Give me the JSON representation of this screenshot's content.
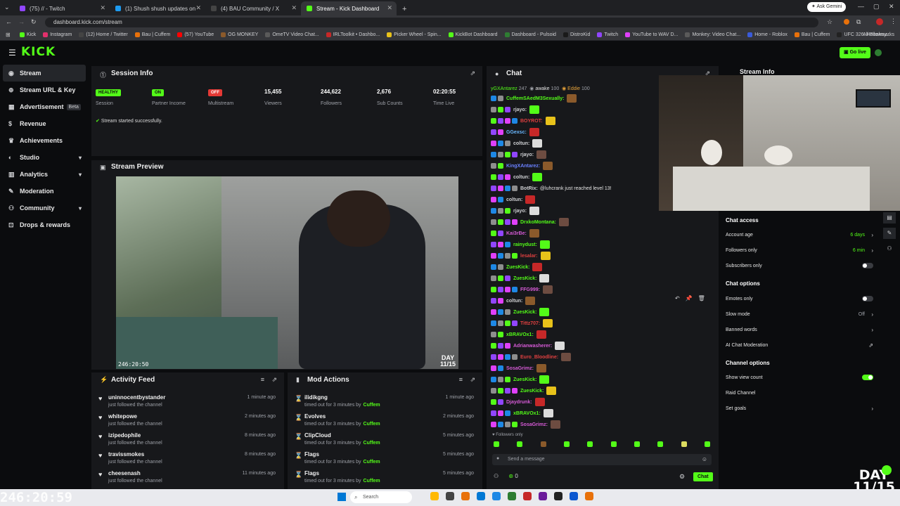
{
  "browser": {
    "tabs": [
      {
        "title": "(75) // - Twitch",
        "color": "#9146ff"
      },
      {
        "title": "(1) Shush shush updates on",
        "color": "#1d9bf0"
      },
      {
        "title": "(4) BAU Community / X",
        "color": "#111"
      },
      {
        "title": "Stream - Kick Dashboard",
        "color": "#53fc18",
        "active": true
      }
    ],
    "new_tab": "+",
    "ask_gemini": "Ask Gemini",
    "url": "dashboard.kick.com/stream",
    "bookmarks": [
      "Kick",
      "Instagram",
      "(12) Home / Twitter",
      "Bau | Cuffem",
      "(57) YouTube",
      "OG MONKEY",
      "OmeTV Video Chat...",
      "IRLToolkit • Dashbo...",
      "Picker Wheel - Spin...",
      "KickBot Dashboard",
      "Dashboard - Pulsoid",
      "DistroKid",
      "Twitch",
      "YouTube to WAV D...",
      "Monkey: Video Chat...",
      "Home - Roblox",
      "Bau | Cuffem",
      "UFC 326: Holloway..."
    ],
    "all_bookmarks": "All Bookmarks"
  },
  "app": {
    "logo": "KICK",
    "go_live": "Go live",
    "accent": "#53fc18"
  },
  "sidebar": {
    "items": [
      {
        "label": "Stream",
        "icon": "stream-icon",
        "active": true
      },
      {
        "label": "Stream URL & Key",
        "icon": "globe-icon"
      },
      {
        "label": "Advertisement",
        "icon": "ad-icon",
        "badge": "Beta"
      },
      {
        "label": "Revenue",
        "icon": "dollar-icon"
      },
      {
        "label": "Achievements",
        "icon": "trophy-icon"
      },
      {
        "label": "Studio",
        "icon": "studio-icon",
        "chevron": true
      },
      {
        "label": "Analytics",
        "icon": "analytics-icon",
        "chevron": true
      },
      {
        "label": "Moderation",
        "icon": "wrench-icon"
      },
      {
        "label": "Community",
        "icon": "community-icon",
        "chevron": true
      },
      {
        "label": "Drops & rewards",
        "icon": "gift-icon"
      }
    ]
  },
  "session": {
    "title": "Session Info",
    "stats": [
      {
        "value": "HEALTHY",
        "label": "Session",
        "pill": true,
        "color": "#53fc18"
      },
      {
        "value": "ON",
        "label": "Partner Income",
        "pill": true,
        "color": "#53fc18"
      },
      {
        "value": "OFF",
        "label": "Multistream",
        "pill": true,
        "color": "#e53935"
      },
      {
        "value": "15,455",
        "label": "Viewers"
      },
      {
        "value": "244,622",
        "label": "Followers"
      },
      {
        "value": "2,676",
        "label": "Sub Counts"
      },
      {
        "value": "02:20:55",
        "label": "Time Live"
      }
    ],
    "notice": "Stream started successfully."
  },
  "preview": {
    "title": "Stream Preview",
    "timer": "246:20:50",
    "day_label": "DAY",
    "day_value": "11/15"
  },
  "activity": {
    "title": "Activity Feed",
    "items": [
      {
        "name": "uninnocentbystander",
        "sub": "just followed the channel",
        "time": "1 minute ago"
      },
      {
        "name": "whitepowe",
        "sub": "just followed the channel",
        "time": "2 minutes ago"
      },
      {
        "name": "izipedophile",
        "sub": "just followed the channel",
        "time": "8 minutes ago"
      },
      {
        "name": "travissmokes",
        "sub": "just followed the channel",
        "time": "8 minutes ago"
      },
      {
        "name": "cheesenash",
        "sub": "just followed the channel",
        "time": "11 minutes ago"
      }
    ]
  },
  "mod_actions": {
    "title": "Mod Actions",
    "by_prefix": "timed out for 3 minutes by",
    "by_name": "Cuffem",
    "items": [
      {
        "name": "ilidikgng",
        "time": "1 minute ago"
      },
      {
        "name": "Evolves",
        "time": "2 minutes ago"
      },
      {
        "name": "ClipCloud",
        "time": "5 minutes ago"
      },
      {
        "name": "Flags",
        "time": "5 minutes ago"
      },
      {
        "name": "Flags",
        "time": "5 minutes ago"
      }
    ]
  },
  "chat": {
    "title": "Chat",
    "header_users": [
      {
        "name": "yGXAntarez",
        "count": "247"
      },
      {
        "name": "awake",
        "count": "100"
      },
      {
        "name": "Eddie",
        "count": "100"
      }
    ],
    "lines": [
      {
        "user": "CuffemSAedM3Sexually:",
        "color": "#53fc18",
        "msg": ""
      },
      {
        "user": "rjayo:",
        "color": "#cfd0d3",
        "msg": ""
      },
      {
        "user": "BOYROT:",
        "color": "#e04040",
        "msg": ""
      },
      {
        "user": "GGexsc:",
        "color": "#6ab8ff",
        "msg": ""
      },
      {
        "user": "coltun:",
        "color": "#cfd0d3",
        "msg": ""
      },
      {
        "user": "rjayo:",
        "color": "#cfd0d3",
        "msg": ""
      },
      {
        "user": "KingXAntarez:",
        "color": "#6a80ff",
        "msg": ""
      },
      {
        "user": "coltun:",
        "color": "#cfd0d3",
        "msg": ""
      },
      {
        "user": "BotRix:",
        "color": "#cfd0d3",
        "msg": "@luhcrank just reached level 13!"
      },
      {
        "user": "coltun:",
        "color": "#cfd0d3",
        "msg": ""
      },
      {
        "user": "rjayo:",
        "color": "#cfd0d3",
        "msg": ""
      },
      {
        "user": "DrxkoMontana:",
        "color": "#53fc18",
        "msg": ""
      },
      {
        "user": "Kai3rBe:",
        "color": "#d65ad6",
        "msg": ""
      },
      {
        "user": "rainydust:",
        "color": "#53fc18",
        "msg": ""
      },
      {
        "user": "lesalar:",
        "color": "#e04040",
        "msg": ""
      },
      {
        "user": "ZuesKick:",
        "color": "#53fc18",
        "msg": ""
      },
      {
        "user": "ZuesKick:",
        "color": "#53fc18",
        "msg": ""
      },
      {
        "user": "FFG999:",
        "color": "#d65ad6",
        "msg": ""
      },
      {
        "user": "coltun:",
        "color": "#cfd0d3",
        "msg": ""
      },
      {
        "user": "ZuesKick:",
        "color": "#53fc18",
        "msg": ""
      },
      {
        "user": "Tittz707:",
        "color": "#e04040",
        "msg": ""
      },
      {
        "user": "xBRAVOx1:",
        "color": "#53fc18",
        "msg": ""
      },
      {
        "user": "Adrianwasherer:",
        "color": "#d65ad6",
        "msg": ""
      },
      {
        "user": "Euro_Bloodline:",
        "color": "#e04040",
        "msg": ""
      },
      {
        "user": "SosaGrimz:",
        "color": "#d65ad6",
        "msg": ""
      },
      {
        "user": "ZuesKick:",
        "color": "#53fc18",
        "msg": ""
      },
      {
        "user": "ZuesKick:",
        "color": "#53fc18",
        "msg": ""
      },
      {
        "user": "Djaydrunk:",
        "color": "#d65ad6",
        "msg": ""
      },
      {
        "user": "xBRAVOx1:",
        "color": "#53fc18",
        "msg": ""
      },
      {
        "user": "SosaGrimz:",
        "color": "#d65ad6",
        "msg": ""
      }
    ],
    "followers_only": "Followers only",
    "placeholder": "Send a message",
    "count": "0",
    "send": "Chat"
  },
  "stream_info_overlay": "Stream Info",
  "chat_settings": {
    "access_title": "Chat access",
    "account_age": {
      "label": "Account age",
      "value": "6 days"
    },
    "followers_only": {
      "label": "Followers only",
      "value": "6 min"
    },
    "subscribers_only": {
      "label": "Subscribers only"
    },
    "options_title": "Chat options",
    "emotes_only": {
      "label": "Emotes only"
    },
    "slow_mode": {
      "label": "Slow mode",
      "value": "Off"
    },
    "banned_words": {
      "label": "Banned words"
    },
    "ai_moderation": {
      "label": "AI Chat Moderation"
    },
    "channel_title": "Channel options",
    "show_view_count": {
      "label": "Show view count"
    },
    "raid_channel": {
      "label": "Raid Channel"
    },
    "set_goals": {
      "label": "Set goals"
    }
  },
  "overlay": {
    "clock": "246:20:59",
    "day_label": "DAY",
    "day_value": "11/15"
  },
  "taskbar": {
    "search": "Search"
  }
}
